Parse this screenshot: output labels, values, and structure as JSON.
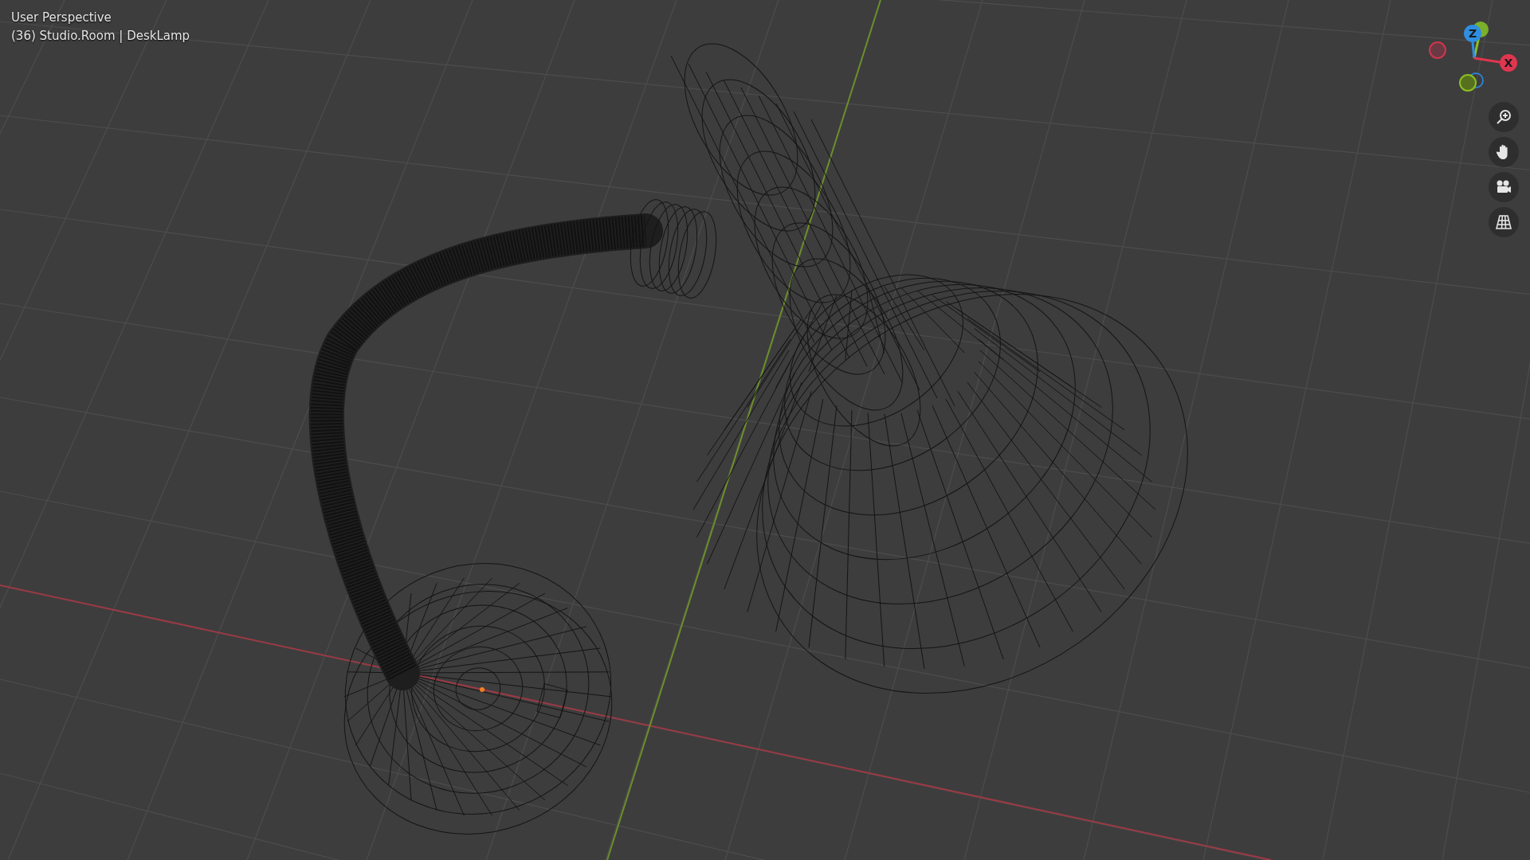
{
  "viewport": {
    "view_name": "User Perspective",
    "object_info": "(36) Studio.Room | DeskLamp"
  },
  "gizmo": {
    "axes": [
      {
        "kind": "z",
        "label": "Z"
      },
      {
        "kind": "x",
        "label": "X"
      }
    ]
  },
  "nav_buttons": [
    {
      "kind": "zoom"
    },
    {
      "kind": "pan"
    },
    {
      "kind": "camera"
    },
    {
      "kind": "grid"
    }
  ]
}
